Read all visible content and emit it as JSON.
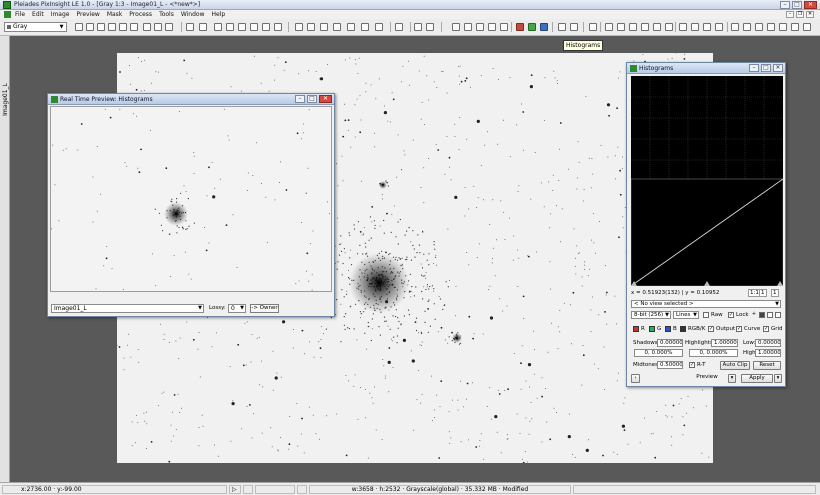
{
  "app": {
    "window_title": "Pleiades PixInsight LE 1.0 - [Gray 1:3 - Image01_L - <*new*>]"
  },
  "menu": [
    "File",
    "Edit",
    "Image",
    "Preview",
    "Mask",
    "Process",
    "Tools",
    "Window",
    "Help"
  ],
  "toolbar": {
    "colorspace_value": "Gray",
    "tooltip": "Histograms"
  },
  "left_tab": {
    "label": "Image01_L"
  },
  "rtp": {
    "title": "Real Time Preview: Histograms",
    "view_select": "Image01_L",
    "lossy_label": "Lossy:",
    "lossy_value": "0",
    "owner_button": "-> Owner"
  },
  "histograms": {
    "title": "Histograms",
    "coords": "x = 0.51923(132) | y = 0.10952",
    "zoom_left": "1:1",
    "zoom_x": "1",
    "zoom_y": "1",
    "view_select": "< No view selected >",
    "resolution_select": "8-bit (256)",
    "style_select": "Lines",
    "raw_label": "Raw",
    "raw_checked": false,
    "lock_label": "Lock",
    "lock_checked": true,
    "channels": {
      "r": "R",
      "g": "G",
      "b": "B",
      "rgbk": "RGB/K",
      "r_color": "#c0392b",
      "g_color": "#27ae60",
      "b_color": "#2c55c8",
      "k_color": "#333333"
    },
    "output_label": "Output",
    "curve_label": "Curve",
    "grid_label": "Grid",
    "shadows_label": "Shadows:",
    "shadows_value": "0.00000",
    "shadows_clip": "0,  0.000%",
    "highlights_label": "Highlights:",
    "highlights_value": "1.00000",
    "highlights_clip": "0,  0.000%",
    "low_label": "Low:",
    "low_value": "0.00000",
    "high_label": "High:",
    "high_value": "1.00000",
    "midtones_label": "Midtones:",
    "midtones_value": "0.50000",
    "rt_label": "R-T",
    "autoclip_button": "Auto Clip",
    "reset_button": "Reset",
    "preview_button": "Preview",
    "apply_button": "Apply"
  },
  "status": {
    "cursor": "x:2736.00 · y:-99.00",
    "image_info": "w:3658 · h:2532 · Grayscale(global) · 35.332 MB · Modified"
  }
}
